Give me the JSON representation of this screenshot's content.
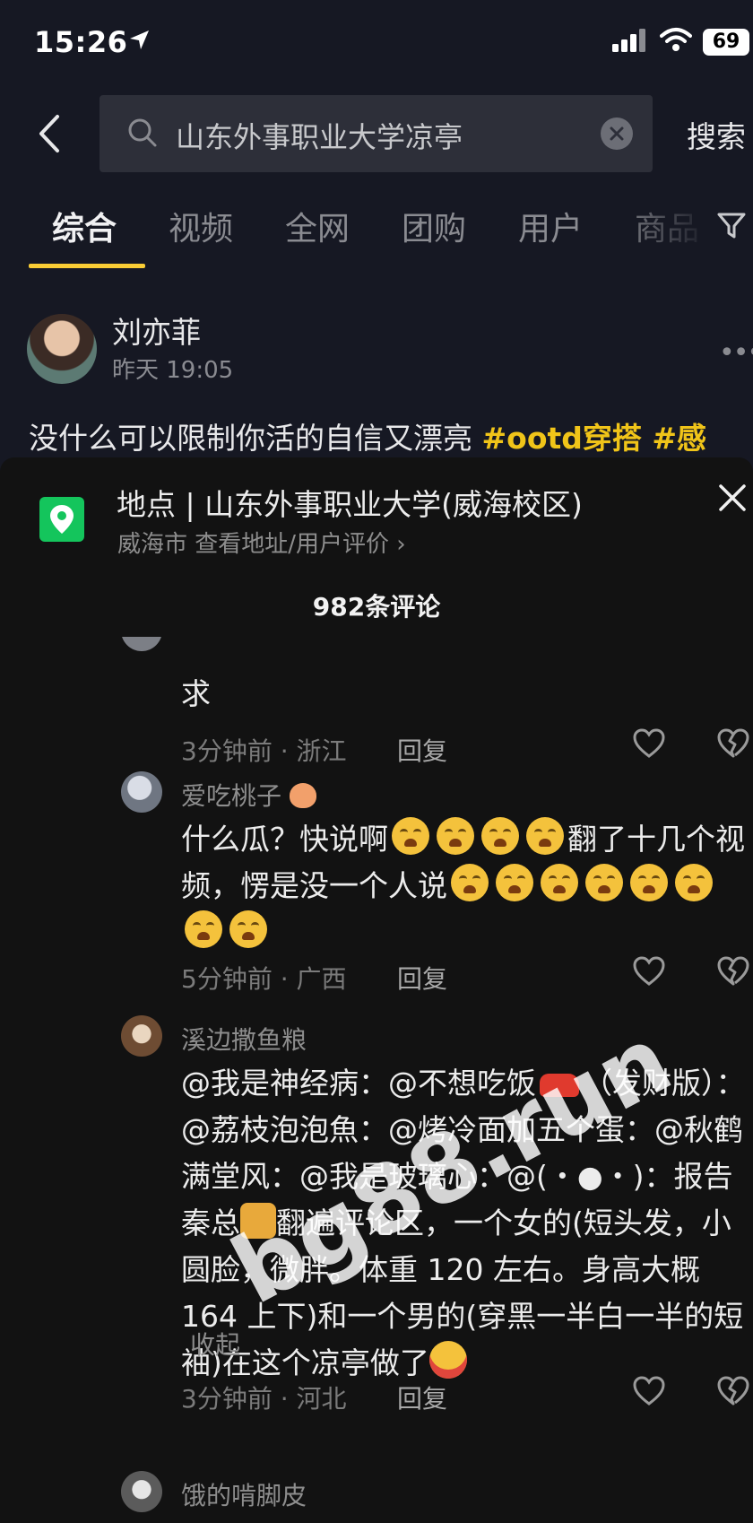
{
  "status_bar": {
    "time": "15:26",
    "battery": "69"
  },
  "search": {
    "query": "山东外事职业大学凉亭",
    "submit_label": "搜索"
  },
  "tabs": [
    "综合",
    "视频",
    "全网",
    "团购",
    "用户",
    "商品"
  ],
  "post": {
    "username": "刘亦菲",
    "time": "昨天 19:05",
    "text": "没什么可以限制你活的自信又漂亮 ",
    "tags": "#ootd穿搭 #感"
  },
  "location": {
    "title": "地点 | 山东外事职业大学(威海校区)",
    "subtitle": "威海市  查看地址/用户评价 ›"
  },
  "comment_count": "982条评论",
  "comments": [
    {
      "text": "求",
      "meta": "3分钟前 · 浙江",
      "reply": "回复"
    },
    {
      "name": "爱吃桃子",
      "text_a": "什么瓜？快说啊",
      "text_b": "翻了十几个视频，愣是没一个人说",
      "meta": "5分钟前 · 广西",
      "reply": "回复"
    },
    {
      "name": "溪边撒鱼粮",
      "text_a": "@我是神经病：@不想吃饭",
      "text_b": "（发财版）：@荔枝泡泡魚：@烤冷面加五个蛋：@秋鹤满堂风：@我是玻璃心：@(・●・)：报告秦总",
      "text_c": "翻遍评论区，一个女的(短头发，小圆脸，微胖。体重 120 左右。身高大概 164 上下)和一个男的(穿黑一半白一半的短袖)在这个凉亭做了",
      "collapse": "收起",
      "meta": "3分钟前 · 河北",
      "reply": "回复"
    },
    {
      "name": "饿的啃脚皮"
    }
  ],
  "watermark": "bg88.run",
  "colors": {
    "accent_yellow": "#facd35",
    "tag_color": "#f0c419",
    "location_green": "#14c55c"
  }
}
